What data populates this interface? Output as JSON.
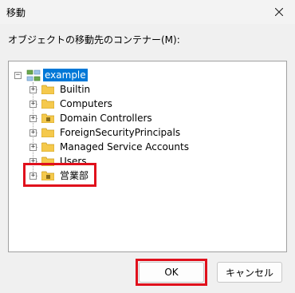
{
  "window": {
    "title": "移動"
  },
  "prompt": "オブジェクトの移動先のコンテナー(M):",
  "tree": {
    "root": "example",
    "children": [
      "Builtin",
      "Computers",
      "Domain Controllers",
      "ForeignSecurityPrincipals",
      "Managed Service Accounts",
      "Users",
      "営業部"
    ]
  },
  "buttons": {
    "ok": "OK",
    "cancel": "キャンセル"
  },
  "colors": {
    "selection": "#0078d7",
    "highlight": "#e0101c",
    "folder": "#f5c94c"
  },
  "icons": {
    "close": "close-icon",
    "folder": "folder-icon",
    "domain": "domain-icon"
  }
}
